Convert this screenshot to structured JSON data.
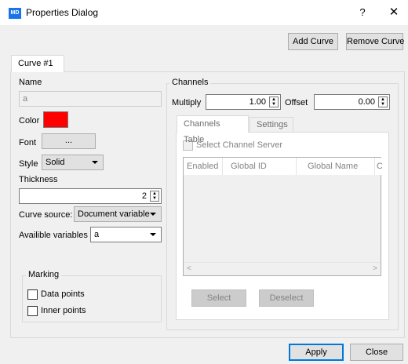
{
  "window": {
    "title": "Properties Dialog",
    "app_icon_text": "MD",
    "help_label": "?",
    "close_label": "✕"
  },
  "toolbar": {
    "add_curve_label": "Add Curve",
    "remove_curve_label": "Remove Curve"
  },
  "tabs": [
    {
      "label": "Curve #1",
      "active": true
    }
  ],
  "left": {
    "name_label": "Name",
    "name_value": "a",
    "color_label": "Color",
    "color_value": "#ff0000",
    "font_label": "Font",
    "font_button": "...",
    "style_label": "Style",
    "style_value": "Solid",
    "thickness_label": "Thickness",
    "thickness_value": "2",
    "curve_source_label": "Curve source:",
    "curve_source_value": "Document variable",
    "available_vars_label": "Availible variables",
    "available_vars_value": "a",
    "marking": {
      "title": "Marking",
      "data_points_label": "Data points",
      "inner_points_label": "Inner points"
    }
  },
  "channels": {
    "title": "Channels",
    "multiply_label": "Multiply",
    "multiply_value": "1.00",
    "offset_label": "Offset",
    "offset_value": "0.00",
    "tabs": [
      "Channels Table",
      "Settings"
    ],
    "select_server_label": "Select Channel Server",
    "table_headers": [
      "Enabled",
      "Global ID",
      "Global Name",
      "C"
    ],
    "select_button": "Select",
    "deselect_button": "Deselect"
  },
  "footer": {
    "apply_label": "Apply",
    "close_label": "Close"
  }
}
